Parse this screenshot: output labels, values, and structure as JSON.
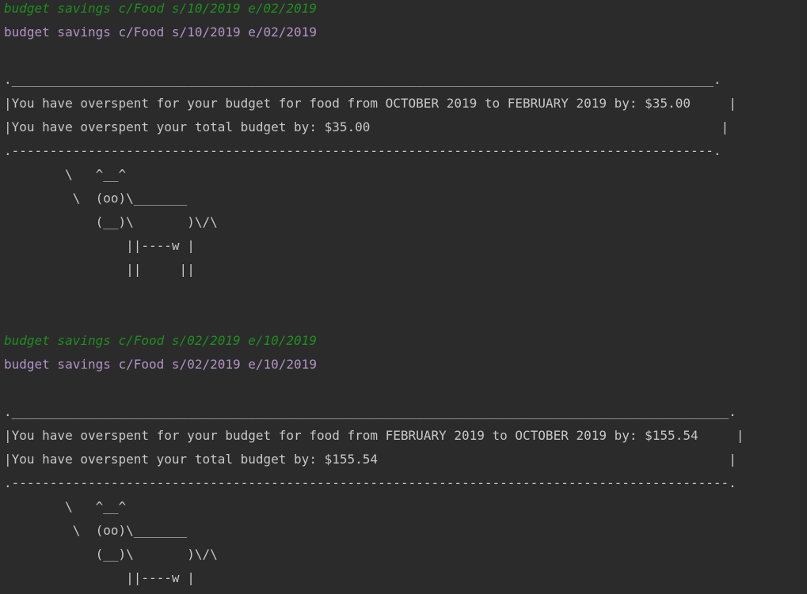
{
  "entries": [
    {
      "input": "budget savings c/Food s/10/2019 e/02/2019",
      "command": "budget savings c/Food s/10/2019 e/02/2019",
      "box_top": ".____________________________________________________________________________________________.",
      "line1": "|You have overspent for your budget for food from OCTOBER 2019 to FEBRUARY 2019 by: $35.00     |",
      "line2": "|You have overspent your total budget by: $35.00                                              |",
      "box_bottom": ".--------------------------------------------------------------------------------------------.",
      "cow": [
        "        \\   ^__^",
        "         \\  (oo)\\_______",
        "            (__)\\       )\\/\\",
        "                ||----w |",
        "                ||     ||"
      ]
    },
    {
      "input": "budget savings c/Food s/02/2019 e/10/2019",
      "command": "budget savings c/Food s/02/2019 e/10/2019",
      "box_top": ".______________________________________________________________________________________________.",
      "line1": "|You have overspent for your budget for food from FEBRUARY 2019 to OCTOBER 2019 by: $155.54     |",
      "line2": "|You have overspent your total budget by: $155.54                                              |",
      "box_bottom": ".----------------------------------------------------------------------------------------------.",
      "cow": [
        "        \\   ^__^",
        "         \\  (oo)\\_______",
        "            (__)\\       )\\/\\",
        "                ||----w |"
      ]
    }
  ]
}
